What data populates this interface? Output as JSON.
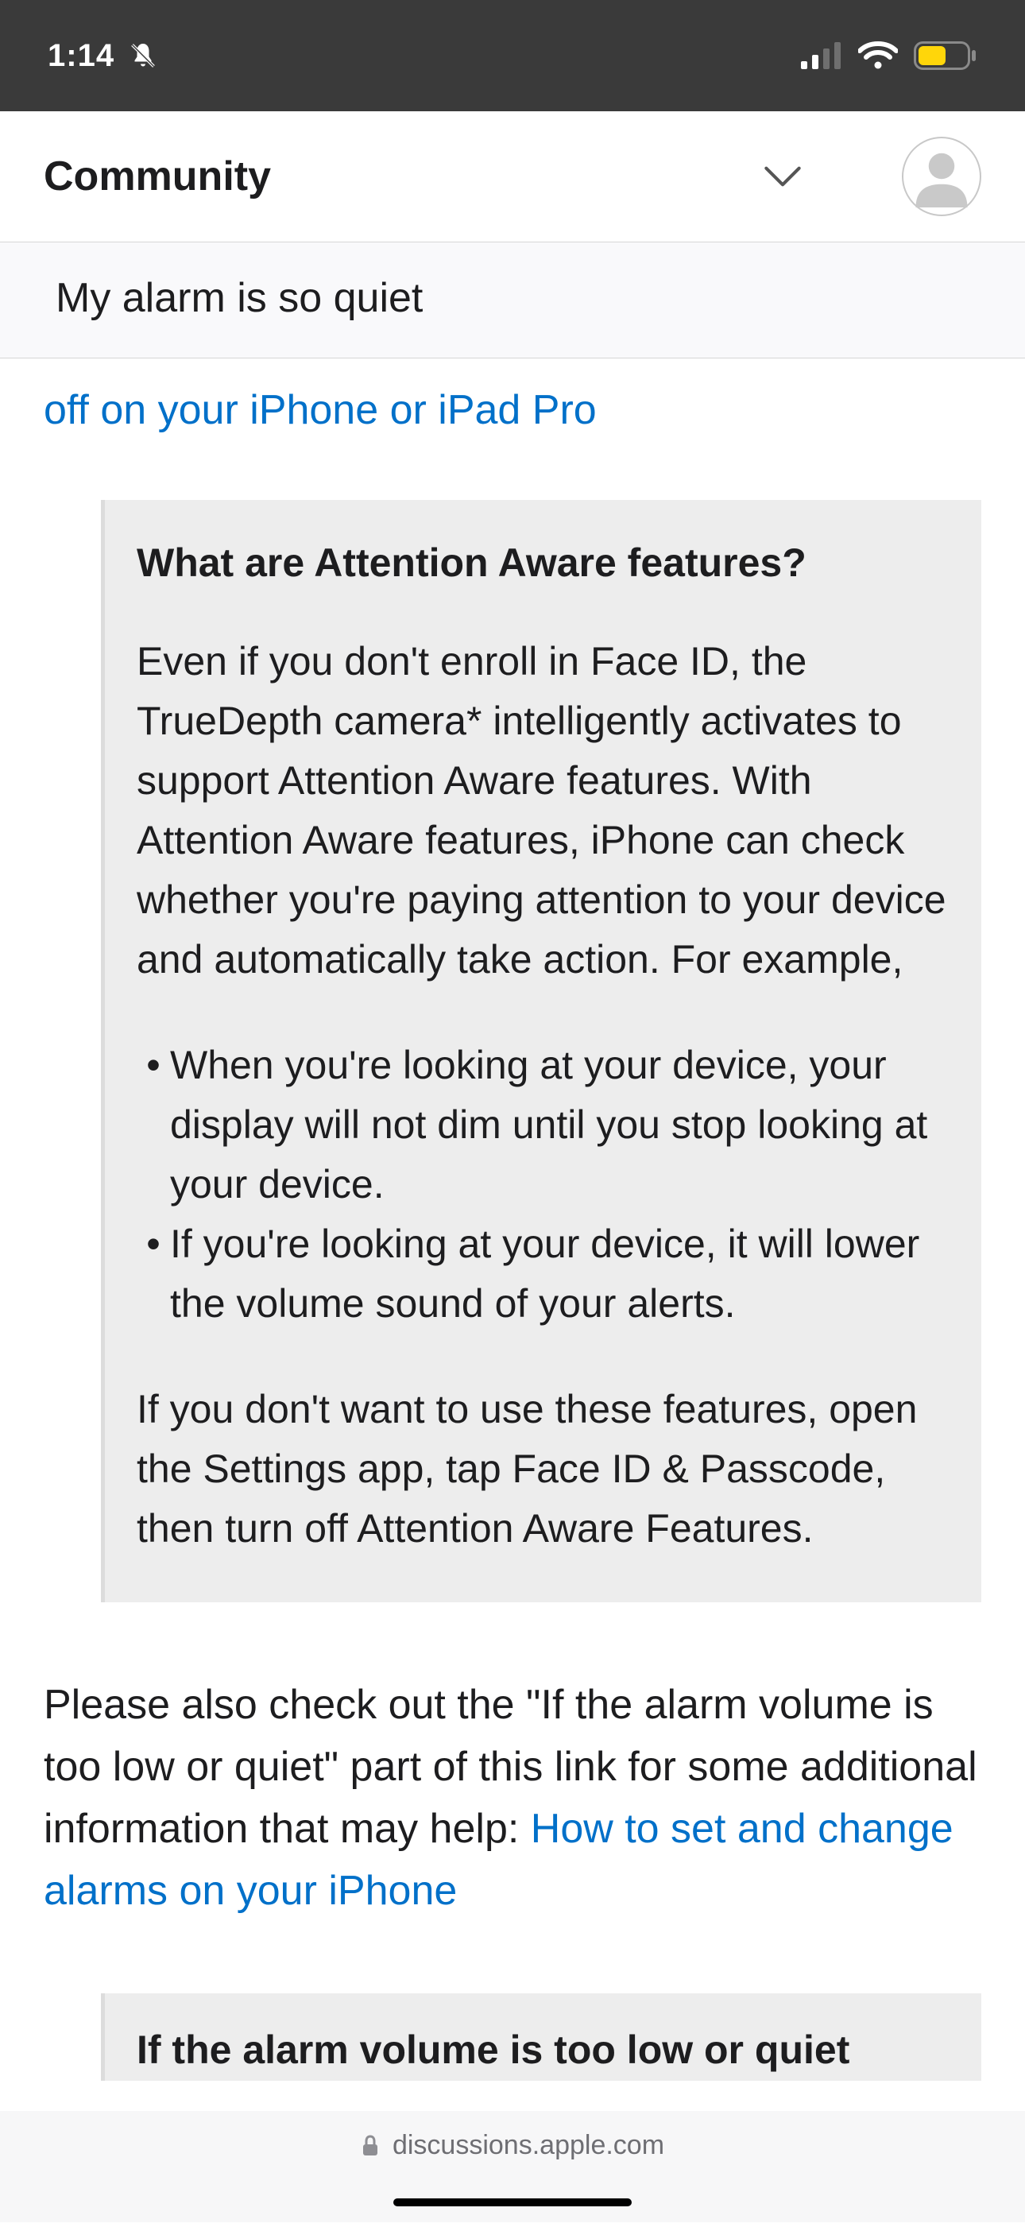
{
  "status": {
    "time": "1:14"
  },
  "nav": {
    "title": "Community"
  },
  "thread": {
    "title": "My alarm is so quiet"
  },
  "content": {
    "cut_link": "off on your iPhone or iPad Pro",
    "quote1": {
      "heading": "What are Attention Aware features?",
      "para1": "Even if you don't enroll in Face ID, the TrueDepth camera* intelligently activates to support Attention Aware features. With Attention Aware features, iPhone can check whether you're paying attention to your device and automatically take action. For example,",
      "items": [
        "When you're looking at your device, your display will not dim until you stop looking at your device.",
        "If you're looking at your device, it will lower the volume sound of your alerts."
      ],
      "para2": "If you don't want to use these features, open the Settings app, tap Face ID & Passcode, then turn off Attention Aware Features."
    },
    "after_quote_pre": "Please also check out the \"If the alarm volume is too low or quiet\" part of this link for some additional information that may help: ",
    "after_quote_link": "How to set and change alarms on your iPhone",
    "quote2": {
      "heading": "If the alarm volume is too low or quiet"
    }
  },
  "browser": {
    "url": "discussions.apple.com"
  }
}
